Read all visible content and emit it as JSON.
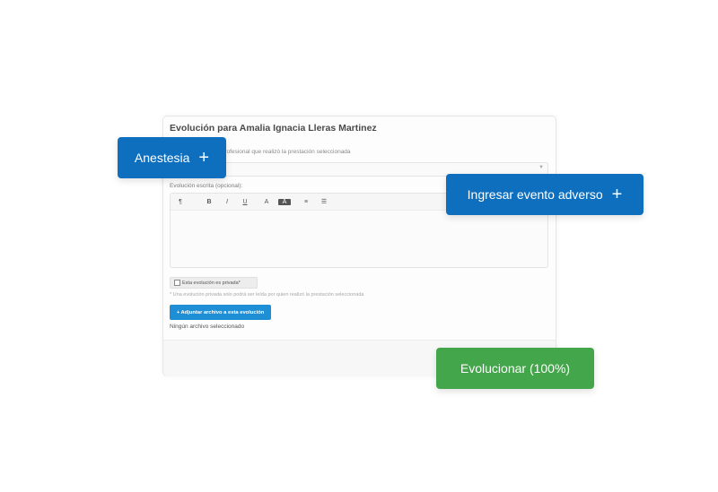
{
  "form": {
    "title": "Evolución para Amalia Ignacia Lleras Martinez",
    "professional_label": "Profesional que realizó la prestación seleccionada",
    "professional_value": "",
    "evolution_label": "Evolución escrita (opcional):",
    "toolbar": {
      "heading": "¶",
      "bold": "B",
      "italic": "I",
      "underline": "U",
      "text_color": "A",
      "bg_color": "A",
      "unordered_list": "≡",
      "ordered_list": "☰"
    },
    "private_label": "Esta evolución es privada*",
    "private_note": "* Una evolución privada solo podrá ser leída por quien realizó la prestación seleccionada",
    "attach_button": "+ Adjuntar archivo a esta evolución",
    "no_file": "Ningún archivo seleccionado"
  },
  "chips": {
    "anestesia": "Anestesia",
    "adverso": "Ingresar evento adverso",
    "evolucionar": "Evolucionar (100%)"
  },
  "colors": {
    "blue": "#0e6fbf",
    "green": "#43a64a",
    "attach_blue": "#1e8fd4"
  }
}
